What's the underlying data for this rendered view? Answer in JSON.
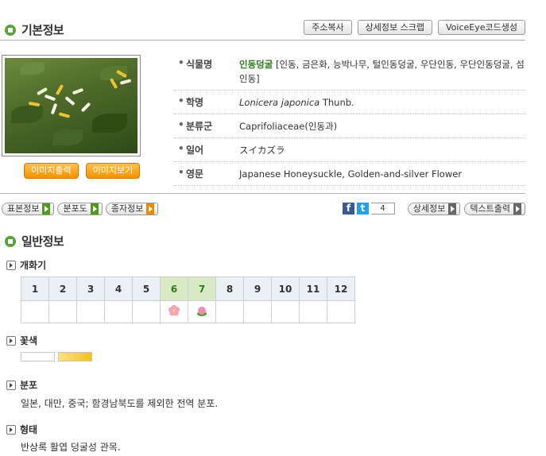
{
  "basic": {
    "title": "기본정보",
    "buttons": [
      "주소복사",
      "상세정보 스크랩",
      "VoiceEye코드생성"
    ]
  },
  "photo": {
    "buttons": [
      "이미지출력",
      "이미지보기"
    ]
  },
  "info": [
    {
      "key": "식물명",
      "name": "인동덩굴",
      "value": " [인동, 금은화, 능박나무, 털인동덩굴, 우단인동, 우단인동덩굴, 섬인동]"
    },
    {
      "key": "학명",
      "italic": "Lonicera japonica",
      "value": " Thunb."
    },
    {
      "key": "분류군",
      "value": "Caprifoliaceae(인동과)"
    },
    {
      "key": "일어",
      "value": "スイカズラ"
    },
    {
      "key": "영문",
      "value": "Japanese Honeysuckle, Golden-and-silver Flower"
    }
  ],
  "tabs": [
    {
      "label": "표본정보",
      "color": "green"
    },
    {
      "label": "분포도",
      "color": "green"
    },
    {
      "label": "종자정보",
      "color": "orange"
    }
  ],
  "social": {
    "fb": "f",
    "tw": "t",
    "count": "4"
  },
  "right_buttons": [
    "상세정보",
    "텍스트출력"
  ],
  "general": {
    "title": "일반정보",
    "bloom": {
      "title": "개화기",
      "months": [
        "1",
        "2",
        "3",
        "4",
        "5",
        "6",
        "7",
        "8",
        "9",
        "10",
        "11",
        "12"
      ],
      "active": [
        6,
        7
      ]
    },
    "color": {
      "title": "꽃색",
      "swatches": [
        "#ffffff",
        "#f3c21a"
      ]
    },
    "distribution": {
      "title": "분포",
      "text": "일본, 대만, 중국; 함경남북도를 제외한 전역 분포."
    },
    "form": {
      "title": "형태",
      "text": "반상록 활엽 덩굴성 관목."
    }
  },
  "colors": {
    "accent": "#5aa23a",
    "orange": "#f39200",
    "green_text": "#2a7d1a"
  }
}
